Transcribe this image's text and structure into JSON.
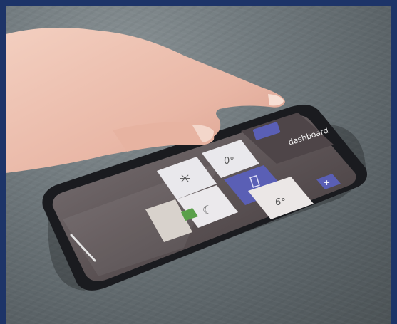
{
  "photo": {
    "subject": "hand-tapping-smartphone",
    "surface": "slate-stone",
    "frame_color": "#1d3468"
  },
  "phone": {
    "header_title": "dashboard",
    "tiles": [
      {
        "id": "fan",
        "icon": "asterisk-icon",
        "symbol": "✳",
        "style": "light"
      },
      {
        "id": "temperature",
        "icon": "degree-icon",
        "symbol": "0°",
        "style": "light"
      },
      {
        "id": "door",
        "icon": "door-icon",
        "symbol": "",
        "style": "accent"
      },
      {
        "id": "night",
        "icon": "moon-icon",
        "symbol": "☾",
        "style": "light"
      },
      {
        "id": "gauge",
        "icon": "dial-icon",
        "symbol": "6°",
        "style": "light"
      },
      {
        "id": "add",
        "icon": "plus-icon",
        "symbol": "+",
        "style": "accent"
      }
    ],
    "colors": {
      "accent": "#5a5fb5",
      "tile": "#e9e8ec",
      "body": "#1a1b1f"
    }
  }
}
